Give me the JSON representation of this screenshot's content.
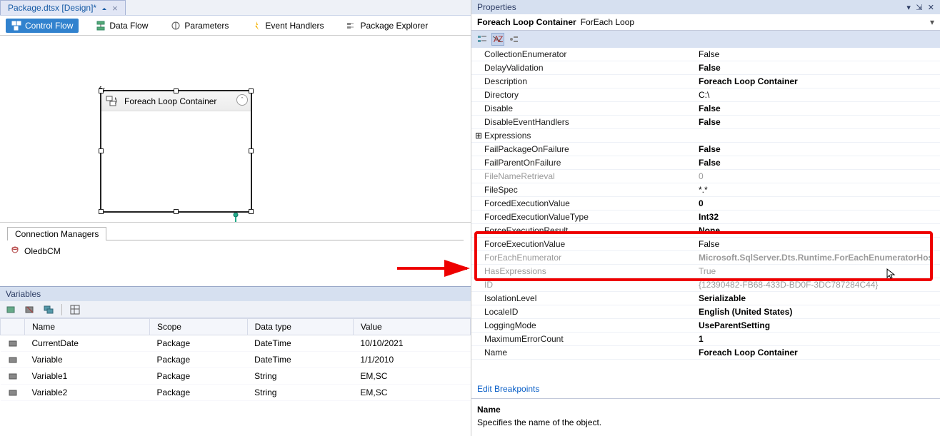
{
  "tab": {
    "label": "Package.dtsx [Design]*"
  },
  "toolbar": {
    "control_flow": "Control Flow",
    "data_flow": "Data Flow",
    "parameters": "Parameters",
    "event_handlers": "Event Handlers",
    "package_explorer": "Package Explorer"
  },
  "designer": {
    "loop_container_label": "Foreach Loop Container",
    "fx_badge": "fx"
  },
  "connection_managers": {
    "tab_label": "Connection Managers",
    "items": [
      {
        "name": "OledbCM"
      }
    ]
  },
  "variables_panel": {
    "title": "Variables",
    "columns": {
      "name": "Name",
      "scope": "Scope",
      "data_type": "Data type",
      "value": "Value"
    },
    "rows": [
      {
        "name": "CurrentDate",
        "scope": "Package",
        "data_type": "DateTime",
        "value": "10/10/2021"
      },
      {
        "name": "Variable",
        "scope": "Package",
        "data_type": "DateTime",
        "value": "1/1/2010"
      },
      {
        "name": "Variable1",
        "scope": "Package",
        "data_type": "String",
        "value": "EM,SC"
      },
      {
        "name": "Variable2",
        "scope": "Package",
        "data_type": "String",
        "value": "EM,SC"
      }
    ]
  },
  "properties": {
    "panel_title": "Properties",
    "object_type": "Foreach Loop Container",
    "object_name": "ForEach Loop",
    "rows": [
      {
        "name": "CollectionEnumerator",
        "value": "False",
        "bold": false
      },
      {
        "name": "DelayValidation",
        "value": "False",
        "bold": true
      },
      {
        "name": "Description",
        "value": "Foreach Loop Container",
        "bold": true
      },
      {
        "name": "Directory",
        "value": "C:\\",
        "bold": false
      },
      {
        "name": "Disable",
        "value": "False",
        "bold": true
      },
      {
        "name": "DisableEventHandlers",
        "value": "False",
        "bold": true
      },
      {
        "name": "Expressions",
        "value": "",
        "bold": false,
        "expand": true
      },
      {
        "name": "FailPackageOnFailure",
        "value": "False",
        "bold": true
      },
      {
        "name": "FailParentOnFailure",
        "value": "False",
        "bold": true
      },
      {
        "name": "FileNameRetrieval",
        "value": "0",
        "bold": false,
        "readonly": true
      },
      {
        "name": "FileSpec",
        "value": "*.*",
        "bold": false
      },
      {
        "name": "ForcedExecutionValue",
        "value": "0",
        "bold": true
      },
      {
        "name": "ForcedExecutionValueType",
        "value": "Int32",
        "bold": true
      },
      {
        "name": "ForceExecutionResult",
        "value": "None",
        "bold": true
      },
      {
        "name": "ForceExecutionValue",
        "value": "False",
        "bold": false
      },
      {
        "name": "ForEachEnumerator",
        "value": "Microsoft.SqlServer.Dts.Runtime.ForEachEnumeratorHos",
        "bold": true,
        "readonly": true
      },
      {
        "name": "HasExpressions",
        "value": "True",
        "bold": false,
        "readonly": true
      },
      {
        "name": "ID",
        "value": "{12390482-FB68-433D-BD0F-3DC787284C44}",
        "bold": false,
        "readonly": true
      },
      {
        "name": "IsolationLevel",
        "value": "Serializable",
        "bold": true
      },
      {
        "name": "LocaleID",
        "value": "English (United States)",
        "bold": true
      },
      {
        "name": "LoggingMode",
        "value": "UseParentSetting",
        "bold": true
      },
      {
        "name": "MaximumErrorCount",
        "value": "1",
        "bold": true
      },
      {
        "name": "Name",
        "value": "Foreach Loop Container",
        "bold": true
      }
    ],
    "link": "Edit Breakpoints",
    "desc_title": "Name",
    "desc_body": "Specifies the name of the object."
  }
}
